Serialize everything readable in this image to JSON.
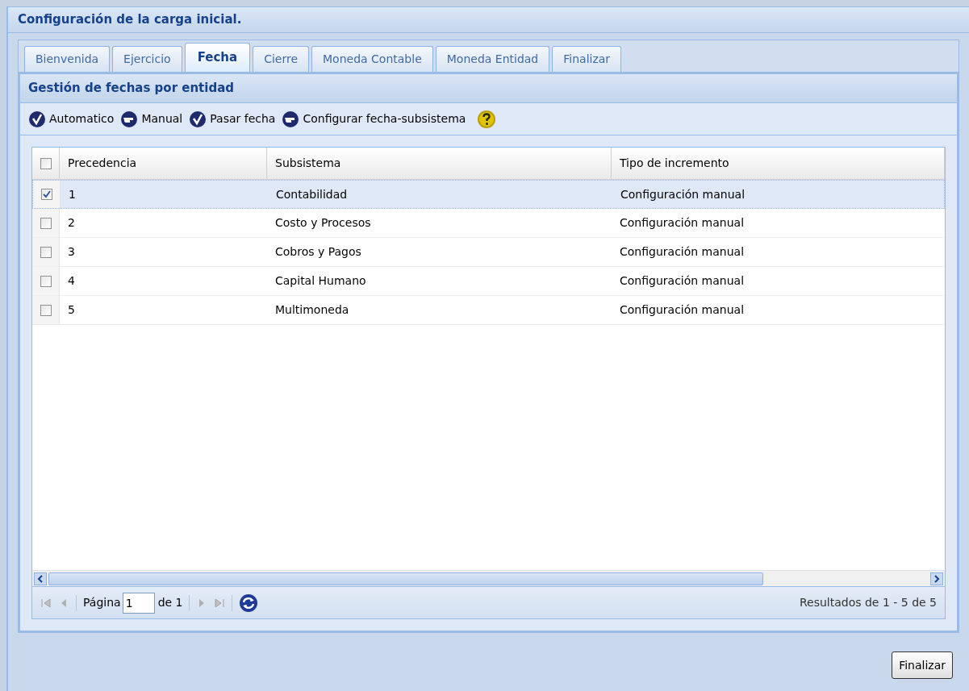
{
  "window": {
    "title": "Configuración de la carga inicial."
  },
  "tabs": [
    {
      "label": "Bienvenida",
      "selected": false
    },
    {
      "label": "Ejercicio",
      "selected": false
    },
    {
      "label": "Fecha",
      "selected": true
    },
    {
      "label": "Cierre",
      "selected": false
    },
    {
      "label": "Moneda Contable",
      "selected": false
    },
    {
      "label": "Moneda Entidad",
      "selected": false
    },
    {
      "label": "Finalizar",
      "selected": false
    }
  ],
  "panel": {
    "title": "Gestión de fechas por entidad"
  },
  "toolbar": [
    {
      "kind": "check",
      "label": "Automatico"
    },
    {
      "kind": "hand",
      "label": "Manual"
    },
    {
      "kind": "check",
      "label": "Pasar fecha"
    },
    {
      "kind": "hand",
      "label": "Configurar fecha-subsistema"
    },
    {
      "kind": "help"
    }
  ],
  "table": {
    "header_checked": false,
    "columns": [
      "Precedencia",
      "Subsistema",
      "Tipo de incremento"
    ],
    "rows": [
      {
        "checked": true,
        "selected": true,
        "cells": [
          "1",
          "Contabilidad",
          "Configuración manual"
        ]
      },
      {
        "checked": false,
        "selected": false,
        "cells": [
          "2",
          "Costo y Procesos",
          "Configuración manual"
        ]
      },
      {
        "checked": false,
        "selected": false,
        "cells": [
          "3",
          "Cobros y Pagos",
          "Configuración manual"
        ]
      },
      {
        "checked": false,
        "selected": false,
        "cells": [
          "4",
          "Capital Humano",
          "Configuración manual"
        ]
      },
      {
        "checked": false,
        "selected": false,
        "cells": [
          "5",
          "Multimoneda",
          "Configuración manual"
        ]
      }
    ]
  },
  "pager": {
    "page_label": "Página",
    "page": "1",
    "of_label": "de 1",
    "summary": "Resultados de 1 - 5 de 5"
  },
  "buttons": [
    "Finalizar"
  ]
}
